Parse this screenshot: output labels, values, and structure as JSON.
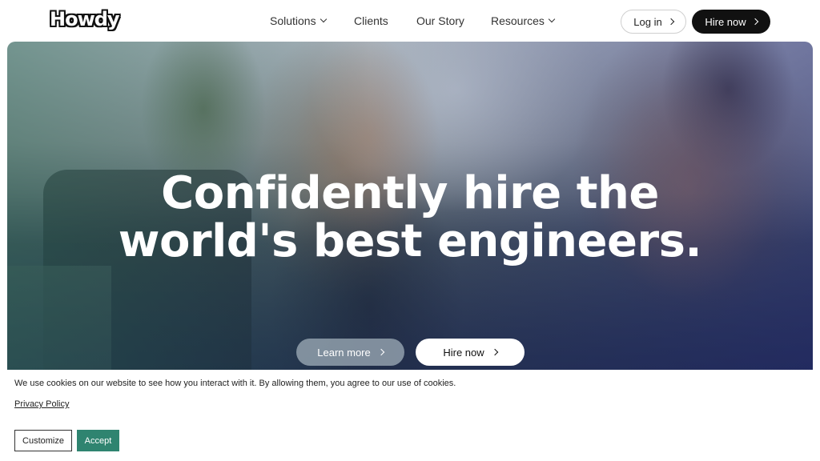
{
  "header": {
    "logo_text": "Howdy",
    "nav": [
      {
        "label": "Solutions"
      },
      {
        "label": "Clients"
      },
      {
        "label": "Our Story"
      },
      {
        "label": "Resources"
      }
    ],
    "login_label": "Log in",
    "hire_label": "Hire now"
  },
  "hero": {
    "title_line1": "Confidently hire the",
    "title_line2": "world's best engineers.",
    "learn_more_label": "Learn more",
    "hire_label": "Hire now"
  },
  "cookie_banner": {
    "text": "We use cookies on our website to see how you interact with it. By allowing them, you agree to our use of cookies.",
    "privacy_label": "Privacy Policy",
    "customize_label": "Customize",
    "accept_label": "Accept"
  },
  "colors": {
    "accent": "#2f8470",
    "dark": "#111111"
  }
}
